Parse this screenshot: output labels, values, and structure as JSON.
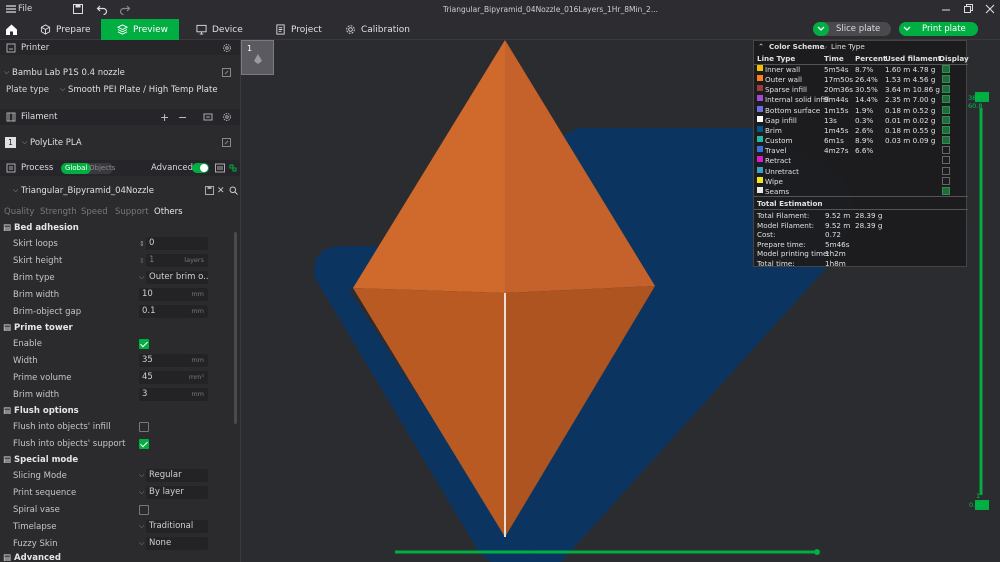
{
  "window": {
    "title": "Triangular_Bipyramid_04Nozzle_016Layers_1Hr_8Min_2...",
    "file_menu": "File"
  },
  "tabs": [
    {
      "label": "Prepare"
    },
    {
      "label": "Preview"
    },
    {
      "label": "Device"
    },
    {
      "label": "Project"
    },
    {
      "label": "Calibration"
    }
  ],
  "actions": {
    "slice_plate": "Slice plate",
    "print_plate": "Print plate"
  },
  "printer": {
    "section_label": "Printer",
    "name": "Bambu Lab P1S 0.4 nozzle",
    "plate_type_label": "Plate type",
    "plate_type_value": "Smooth PEI Plate / High Temp Plate"
  },
  "filament": {
    "section_label": "Filament",
    "slot": "1",
    "name": "PolyLite PLA"
  },
  "process": {
    "section_label": "Process",
    "toggle_global": "Global",
    "toggle_objects": "Objects",
    "advanced_label": "Advanced",
    "profile_name": "Triangular_Bipyramid_04Nozzle",
    "subtabs": [
      "Quality",
      "Strength",
      "Speed",
      "Support",
      "Others"
    ]
  },
  "settings": {
    "bed_adhesion": "Bed adhesion",
    "skirt_loops_label": "Skirt loops",
    "skirt_loops_value": "0",
    "skirt_height_label": "Skirt height",
    "skirt_height_value": "1",
    "skirt_height_unit": "layers",
    "brim_type_label": "Brim type",
    "brim_type_value": "Outer brim o...",
    "brim_width_label": "Brim width",
    "brim_width_value": "10",
    "mm": "mm",
    "brim_gap_label": "Brim-object gap",
    "brim_gap_value": "0.1",
    "prime_tower": "Prime tower",
    "enable_label": "Enable",
    "width_label": "Width",
    "width_value": "35",
    "prime_volume_label": "Prime volume",
    "prime_volume_value": "45",
    "mm3": "mm³",
    "pt_brim_width_label": "Brim width",
    "pt_brim_width_value": "3",
    "flush_options": "Flush options",
    "flush_infill_label": "Flush into objects' infill",
    "flush_support_label": "Flush into objects' support",
    "special_mode": "Special mode",
    "slicing_mode_label": "Slicing Mode",
    "slicing_mode_value": "Regular",
    "print_seq_label": "Print sequence",
    "print_seq_value": "By layer",
    "spiral_label": "Spiral vase",
    "timelapse_label": "Timelapse",
    "timelapse_value": "Traditional",
    "fuzzy_label": "Fuzzy Skin",
    "fuzzy_value": "None",
    "advanced": "Advanced"
  },
  "plate_thumb": {
    "number": "1"
  },
  "legend": {
    "title": "Color Scheme",
    "scheme": "Line Type",
    "headers": [
      "Line Type",
      "Time",
      "Percent",
      "Used filament",
      "Display"
    ],
    "rows": [
      {
        "name": "Inner wall",
        "color": "#f2c200",
        "time": "5m54s",
        "percent": "8.7%",
        "used": "1.60 m  4.78 g",
        "display": true
      },
      {
        "name": "Outer wall",
        "color": "#ff7f1e",
        "time": "17m50s",
        "percent": "26.4%",
        "used": "1.53 m  4.56 g",
        "display": true
      },
      {
        "name": "Sparse infill",
        "color": "#9b3a3f",
        "time": "20m36s",
        "percent": "30.5%",
        "used": "3.64 m  10.86 g",
        "display": true
      },
      {
        "name": "Internal solid infill",
        "color": "#a04bd6",
        "time": "9m44s",
        "percent": "14.4%",
        "used": "2.35 m  7.00 g",
        "display": true
      },
      {
        "name": "Bottom surface",
        "color": "#6b70e0",
        "time": "1m15s",
        "percent": "1.9%",
        "used": "0.18 m  0.52 g",
        "display": true
      },
      {
        "name": "Gap infill",
        "color": "#ffffff",
        "time": "13s",
        "percent": "0.3%",
        "used": "0.01 m  0.02 g",
        "display": true
      },
      {
        "name": "Brim",
        "color": "#00598a",
        "time": "1m45s",
        "percent": "2.6%",
        "used": "0.18 m  0.55 g",
        "display": true
      },
      {
        "name": "Custom",
        "color": "#2ab5a0",
        "time": "6m1s",
        "percent": "8.9%",
        "used": "0.03 m  0.09 g",
        "display": true
      },
      {
        "name": "Travel",
        "color": "#3a6fd6",
        "time": "4m27s",
        "percent": "6.6%",
        "used": "",
        "display": false
      },
      {
        "name": "Retract",
        "color": "#d41ec8",
        "time": "",
        "percent": "",
        "used": "",
        "display": false
      },
      {
        "name": "Unretract",
        "color": "#3aa0c8",
        "time": "",
        "percent": "",
        "used": "",
        "display": false
      },
      {
        "name": "Wipe",
        "color": "#f5e51e",
        "time": "",
        "percent": "",
        "used": "",
        "display": false
      },
      {
        "name": "Seams",
        "color": "#e8e8e8",
        "time": "",
        "percent": "",
        "used": "",
        "display": true
      }
    ],
    "total_title": "Total Estimation",
    "totals": [
      {
        "label": "Total Filament:",
        "value": "9.52 m",
        "value2": "28.39 g"
      },
      {
        "label": "Model Filament:",
        "value": "9.52 m",
        "value2": "28.39 g"
      },
      {
        "label": "Cost:",
        "value": "0.72",
        "value2": ""
      },
      {
        "label": "Prepare time:",
        "value": "5m46s",
        "value2": ""
      },
      {
        "label": "Model printing time:",
        "value": "1h2m",
        "value2": ""
      },
      {
        "label": "Total time:",
        "value": "1h8m",
        "value2": ""
      }
    ]
  },
  "layer_slider": {
    "top_layer": "380",
    "top_height": "60.8",
    "bottom_layer": "1",
    "bottom_height": "0.20"
  },
  "model_colors": {
    "model": "#d0692c",
    "model_dark": "#b85a22",
    "brim": "#0b3560",
    "accent": "#00ae42"
  }
}
